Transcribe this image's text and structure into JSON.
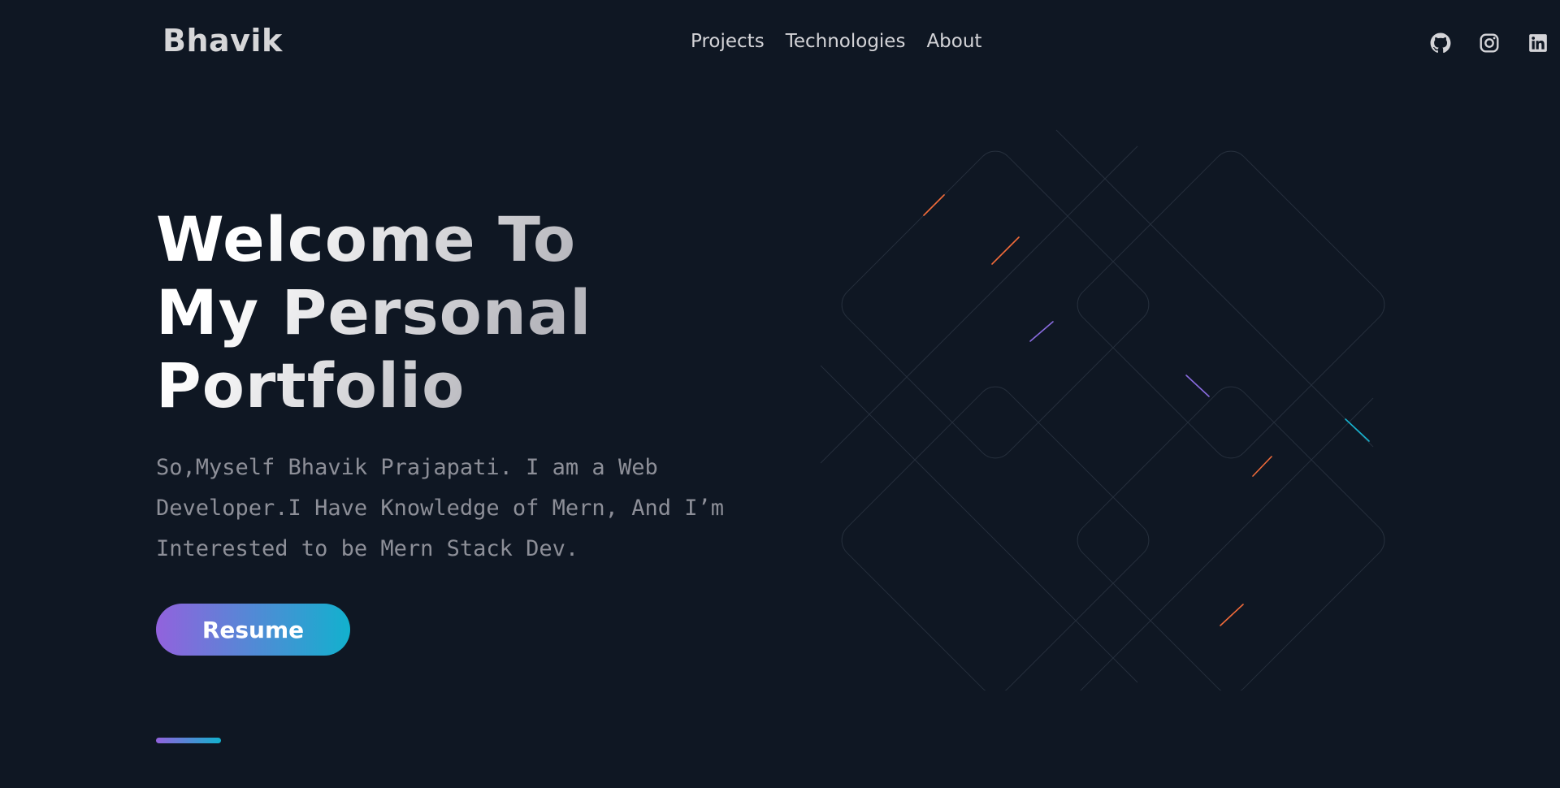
{
  "header": {
    "logo": "Bhavik",
    "nav": [
      {
        "label": "Projects"
      },
      {
        "label": "Technologies"
      },
      {
        "label": "About"
      }
    ],
    "socials": [
      {
        "icon": "github-icon"
      },
      {
        "icon": "instagram-icon"
      },
      {
        "icon": "linkedin-icon"
      }
    ]
  },
  "hero": {
    "title_lines": [
      "Welcome To",
      "My Personal",
      "Portfolio"
    ],
    "description": "So,Myself Bhavik Prajapati. I am a Web Developer.I Have Knowledge of Mern, And I’m Interested to be Mern Stack Dev.",
    "button_label": "Resume"
  },
  "colors": {
    "background": "#0f1723",
    "gradient_start": "#9262dd",
    "gradient_end": "#12b1ce",
    "accent_orange": "#f26b3a"
  }
}
